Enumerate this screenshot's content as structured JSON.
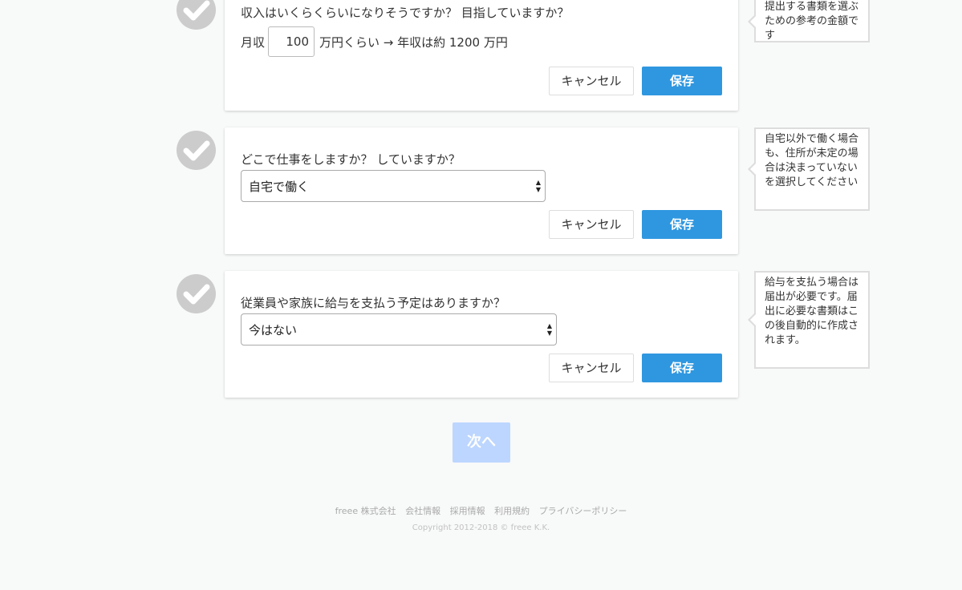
{
  "sections": [
    {
      "question": "収入はいくらくらいになりそうですか？ 目指していますか？",
      "income_prefix": "月収",
      "income_value": "100",
      "income_suffix": "万円くらい → 年収は約 1200 万円",
      "cancel_label": "キャンセル",
      "save_label": "保存",
      "tip": "提出する書類を選ぶための参考の金額です"
    },
    {
      "question": "どこで仕事をしますか？ していますか？",
      "select_value": "自宅で働く",
      "cancel_label": "キャンセル",
      "save_label": "保存",
      "tip": "自宅以外で働く場合も、住所が未定の場合は決まっていないを選択してください"
    },
    {
      "question": "従業員や家族に給与を支払う予定はありますか？",
      "select_value": "今はない",
      "cancel_label": "キャンセル",
      "save_label": "保存",
      "tip": "給与を支払う場合は届出が必要です。届出に必要な書類はこの後自動的に作成されます。"
    }
  ],
  "next_label": "次へ",
  "footer": {
    "links": [
      "freee 株式会社",
      "会社情報",
      "採用情報",
      "利用規約",
      "プライバシーポリシー"
    ],
    "copyright": "Copyright 2012-2018 © freee K.K."
  },
  "colors": {
    "save_button": "#2f97e0",
    "next_button_disabled": "#bcd6ff",
    "check_circle": "#cccccc"
  }
}
